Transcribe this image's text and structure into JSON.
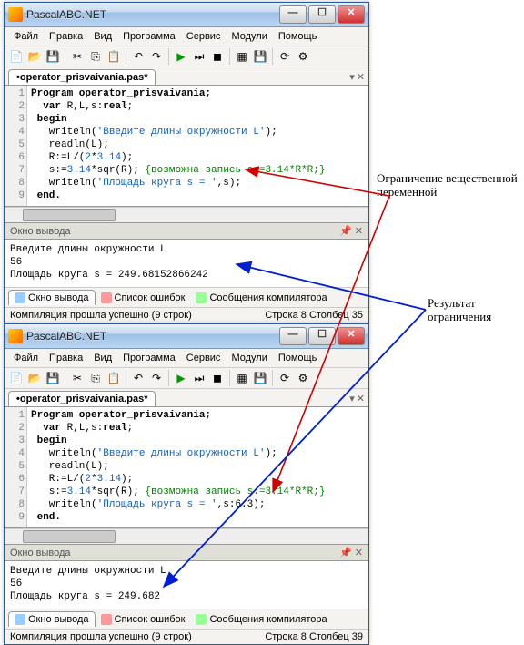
{
  "win1": {
    "title": "PascalABC.NET",
    "menu": [
      "Файл",
      "Правка",
      "Вид",
      "Программа",
      "Сервис",
      "Модули",
      "Помощь"
    ],
    "tab": "•operator_prisvaivania.pas*",
    "code_lines": {
      "l1": "Program operator_prisvaivania;",
      "l2a": "  var ",
      "l2b": "R,L,s:",
      "l2c": "real",
      "l2d": ";",
      "l3": " begin",
      "l4a": "   writeln(",
      "l4b": "'Введите длины окружности L'",
      "l4c": ");",
      "l5": "   readln(L);",
      "l6a": "   R:=L/(",
      "l6b": "2",
      "l6c": "*",
      "l6d": "3.14",
      "l6e": ");",
      "l7a": "   s:=",
      "l7b": "3.14",
      "l7c": "*sqr(R); ",
      "l7com": "{возможна запись s:=3.14*R*R;}",
      "l8a": "   writeln(",
      "l8b": "'Площадь круга s = '",
      "l8c": ",s);",
      "l9": " end."
    },
    "output_header": "Окно вывода",
    "output": "Введите длины окружности L\n56\nПлощадь круга s = 249.68152866242",
    "tabs_bottom": {
      "out": "Окно вывода",
      "err": "Список ошибок",
      "comp": "Сообщения компилятора"
    },
    "status_left": "Компиляция прошла успешно (9 строк)",
    "status_right": "Строка 8 Столбец 35"
  },
  "win2": {
    "title": "PascalABC.NET",
    "menu": [
      "Файл",
      "Правка",
      "Вид",
      "Программа",
      "Сервис",
      "Модули",
      "Помощь"
    ],
    "tab": "•operator_prisvaivania.pas*",
    "code_lines": {
      "l1": "Program operator_prisvaivania;",
      "l2a": "  var ",
      "l2b": "R,L,s:",
      "l2c": "real",
      "l2d": ";",
      "l3": " begin",
      "l4a": "   writeln(",
      "l4b": "'Введите длины окружности L'",
      "l4c": ");",
      "l5": "   readln(L);",
      "l6a": "   R:=L/(",
      "l6b": "2",
      "l6c": "*",
      "l6d": "3.14",
      "l6e": ");",
      "l7a": "   s:=",
      "l7b": "3.14",
      "l7c": "*sqr(R); ",
      "l7com": "{возможна запись s:=3.14*R*R;}",
      "l8a": "   writeln(",
      "l8b": "'Площадь круга s = '",
      "l8c": ",s:6:3);",
      "l9": " end."
    },
    "output_header": "Окно вывода",
    "output": "Введите длины окружности L\n56\nПлощадь круга s = 249.682",
    "tabs_bottom": {
      "out": "Окно вывода",
      "err": "Список ошибок",
      "comp": "Сообщения компилятора"
    },
    "status_left": "Компиляция прошла успешно (9 строк)",
    "status_right": "Строка 8 Столбец 39"
  },
  "annot1": "Ограничение вещественной\nпеременной",
  "annot2": "Результат\nограничения"
}
